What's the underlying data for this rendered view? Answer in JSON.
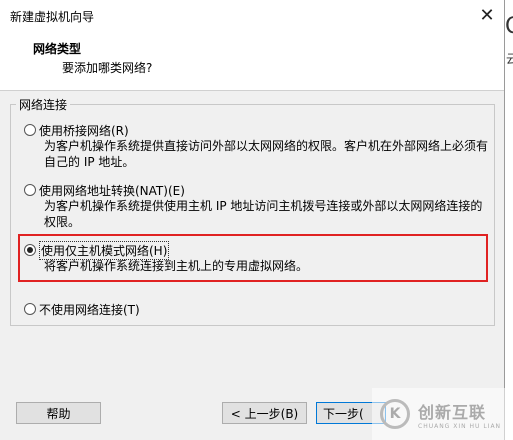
{
  "window": {
    "title": "新建虚拟机向导"
  },
  "header": {
    "title": "网络类型",
    "subtitle": "要添加哪类网络?"
  },
  "group": {
    "legend": "网络连接"
  },
  "options": [
    {
      "label": "使用桥接网络(R)",
      "desc": "为客户机操作系统提供直接访问外部以太网网络的权限。客户机在外部网络上必须有自己的 IP 地址。",
      "selected": false
    },
    {
      "label": "使用网络地址转换(NAT)(E)",
      "desc": "为客户机操作系统提供使用主机 IP 地址访问主机拨号连接或外部以太网网络连接的权限。",
      "selected": false
    },
    {
      "label": "使用仅主机模式网络(H)",
      "desc": "将客户机操作系统连接到主机上的专用虚拟网络。",
      "selected": true
    },
    {
      "label": "不使用网络连接(T)",
      "desc": "",
      "selected": false
    }
  ],
  "buttons": {
    "help": "帮助",
    "back": "< 上一步(B)",
    "next": "下一步("
  },
  "watermark": {
    "logo": "K",
    "cn": "创新互联",
    "en": "CHUANG XIN HU LIAN"
  },
  "background_edge": {
    "glyph": "O",
    "text": "云"
  },
  "colors": {
    "highlight": "#e02222",
    "dialog_bg": "#f0f0f0"
  }
}
